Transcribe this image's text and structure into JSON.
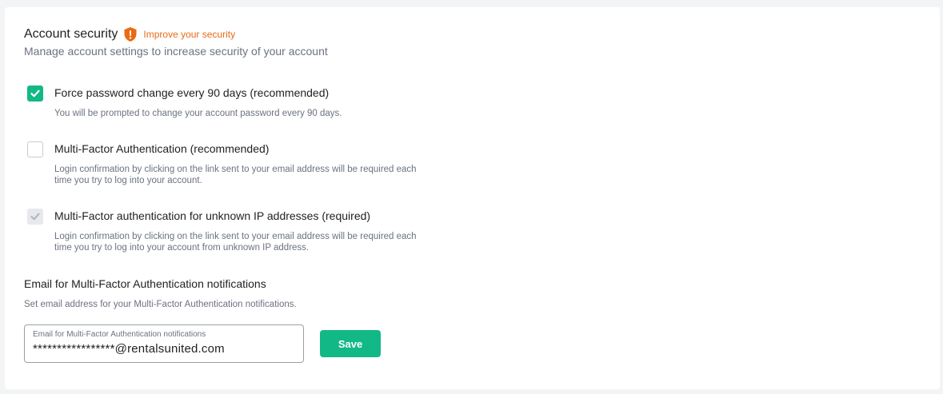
{
  "header": {
    "title": "Account security",
    "improve_link": "Improve your security",
    "subtitle": "Manage account settings to increase security of your account"
  },
  "options": [
    {
      "label": "Force password change every 90 days (recommended)",
      "description": "You will be prompted to change your account password every 90 days.",
      "state": "checked"
    },
    {
      "label": "Multi-Factor Authentication (recommended)",
      "description": "Login confirmation by clicking on the link sent to your email address will be required each time you try to log into your account.",
      "state": "unchecked"
    },
    {
      "label": "Multi-Factor authentication for unknown IP addresses (required)",
      "description": "Login confirmation by clicking on the link sent to your email address will be required each time you try to log into your account from unknown IP address.",
      "state": "checked-disabled"
    }
  ],
  "mfa_email": {
    "section_title": "Email for Multi-Factor Authentication notifications",
    "section_description": "Set email address for your Multi-Factor Authentication notifications.",
    "field_label": "Email for Multi-Factor Authentication notifications",
    "field_value": "*****************@rentalsunited.com",
    "save_label": "Save"
  },
  "icons": {
    "shield": "shield-alert-icon",
    "check": "check-icon"
  },
  "colors": {
    "accent": "#12b886",
    "warning": "#ea6a14",
    "disabled_check": "#e7e9ec"
  }
}
